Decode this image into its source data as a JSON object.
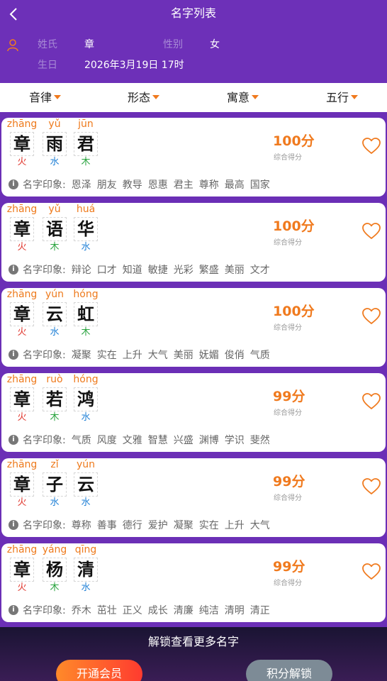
{
  "header": {
    "title": "名字列表",
    "surname_label": "姓氏",
    "surname": "章",
    "gender_label": "性别",
    "gender": "女",
    "birth_label": "生日",
    "birth": "2026年3月19日 17时"
  },
  "tabs": [
    {
      "label": "音律"
    },
    {
      "label": "形态"
    },
    {
      "label": "寓意"
    },
    {
      "label": "五行"
    }
  ],
  "impression_label": "名字印象:",
  "score_label": "综合得分",
  "element_colors": {
    "火": "#e0382f",
    "水": "#1e7fd6",
    "木": "#29a33e"
  },
  "names": [
    {
      "chars": [
        {
          "pinyin": "zhāng",
          "char": "章",
          "element": "火"
        },
        {
          "pinyin": "yǔ",
          "char": "雨",
          "element": "水"
        },
        {
          "pinyin": "jūn",
          "char": "君",
          "element": "木"
        }
      ],
      "score": "100分",
      "keywords": [
        "恩泽",
        "朋友",
        "教导",
        "恩惠",
        "君主",
        "尊称",
        "最高",
        "国家"
      ]
    },
    {
      "chars": [
        {
          "pinyin": "zhāng",
          "char": "章",
          "element": "火"
        },
        {
          "pinyin": "yǔ",
          "char": "语",
          "element": "木"
        },
        {
          "pinyin": "huá",
          "char": "华",
          "element": "水"
        }
      ],
      "score": "100分",
      "keywords": [
        "辩论",
        "口才",
        "知道",
        "敏捷",
        "光彩",
        "繁盛",
        "美丽",
        "文才"
      ]
    },
    {
      "chars": [
        {
          "pinyin": "zhāng",
          "char": "章",
          "element": "火"
        },
        {
          "pinyin": "yún",
          "char": "云",
          "element": "水"
        },
        {
          "pinyin": "hóng",
          "char": "虹",
          "element": "木"
        }
      ],
      "score": "100分",
      "keywords": [
        "凝聚",
        "实在",
        "上升",
        "大气",
        "美丽",
        "妩媚",
        "俊俏",
        "气质"
      ]
    },
    {
      "chars": [
        {
          "pinyin": "zhāng",
          "char": "章",
          "element": "火"
        },
        {
          "pinyin": "ruò",
          "char": "若",
          "element": "木"
        },
        {
          "pinyin": "hóng",
          "char": "鸿",
          "element": "水"
        }
      ],
      "score": "99分",
      "keywords": [
        "气质",
        "风度",
        "文雅",
        "智慧",
        "兴盛",
        "渊博",
        "学识",
        "斐然"
      ]
    },
    {
      "chars": [
        {
          "pinyin": "zhāng",
          "char": "章",
          "element": "火"
        },
        {
          "pinyin": "zǐ",
          "char": "子",
          "element": "水"
        },
        {
          "pinyin": "yún",
          "char": "云",
          "element": "水"
        }
      ],
      "score": "99分",
      "keywords": [
        "尊称",
        "善事",
        "德行",
        "爱护",
        "凝聚",
        "实在",
        "上升",
        "大气"
      ]
    },
    {
      "chars": [
        {
          "pinyin": "zhāng",
          "char": "章",
          "element": "火"
        },
        {
          "pinyin": "yáng",
          "char": "杨",
          "element": "木"
        },
        {
          "pinyin": "qīng",
          "char": "清",
          "element": "水"
        }
      ],
      "score": "99分",
      "keywords": [
        "乔木",
        "茁壮",
        "正义",
        "成长",
        "清廉",
        "纯洁",
        "清明",
        "清正"
      ]
    }
  ],
  "footer": {
    "text": "解锁查看更多名字",
    "vip_button": "开通会员",
    "points_button": "积分解锁"
  }
}
